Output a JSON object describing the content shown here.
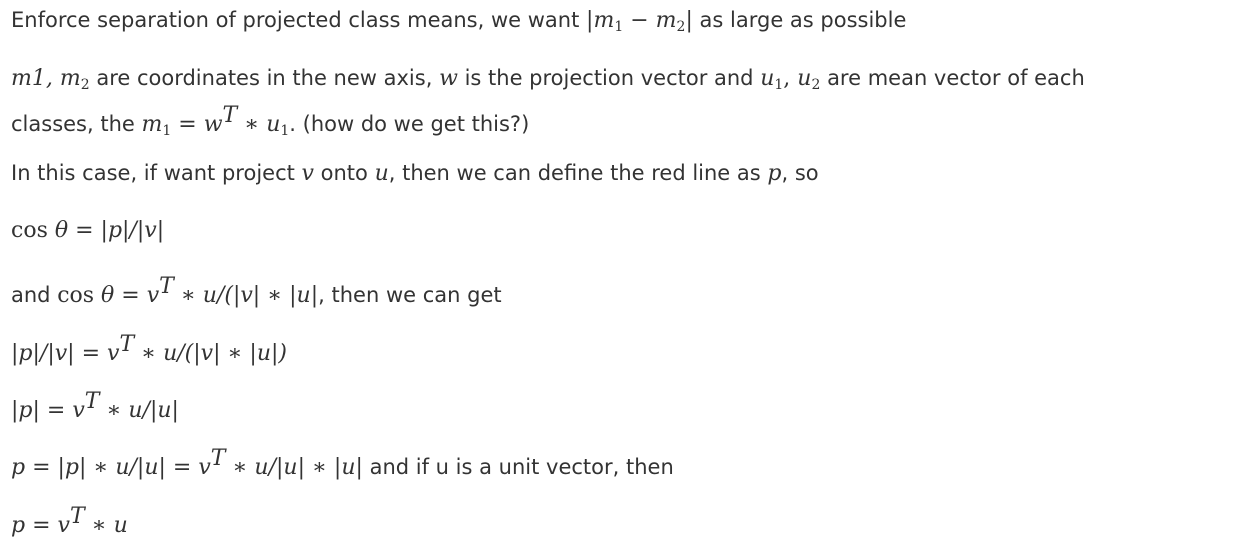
{
  "lines": {
    "l1": {
      "t1": "Enforce separation of projected class means, we want ",
      "math": [
        "|",
        "m",
        "1",
        " − ",
        "m",
        "2",
        "|"
      ],
      "t2": " as large as possible"
    },
    "l2": {
      "m1": "m1, ",
      "m2": "m",
      "m2sub": "2",
      "t1": " are coordinates in the new axis, ",
      "w": "w",
      "t2": " is the projection vector and ",
      "u": "u",
      "u1sub": "1",
      "comma": ", ",
      "u2": "u",
      "u2sub": "2",
      "t3": " are mean vector of each"
    },
    "l3": {
      "t1": "classes, the ",
      "m": "m",
      "msub": "1",
      "eq": " = ",
      "w": "w",
      "wsup": "T",
      "star": " ∗ ",
      "u": "u",
      "usub": "1",
      "t2": ". (how do we get this?)"
    },
    "l4": {
      "t1": "In this case, if want project ",
      "v": "v",
      "t2": " onto ",
      "u": "u",
      "t3": ", then we can define the red line as ",
      "p": "p",
      "t4": ", so"
    },
    "l5": {
      "cos": "cos ",
      "theta": "θ",
      "rest": " = |p|/|v|"
    },
    "l6": {
      "t1": "and ",
      "cos": "cos ",
      "theta": "θ",
      "eq": " = ",
      "v": "v",
      "sup": "T",
      "rest": " ∗ u/(|v| ∗ |u|",
      "t2": ", then we can get"
    },
    "l7": {
      "lhs": "|p|/|v| = ",
      "v": "v",
      "sup": "T",
      "rest": " ∗ u/(|v| ∗ |u|)"
    },
    "l8": {
      "lhs": "|p| = ",
      "v": "v",
      "sup": "T",
      "rest": " ∗ u/|u|"
    },
    "l9": {
      "lhs": "p = |p| ∗ u/|u| = ",
      "v": "v",
      "sup": "T",
      "rest": " ∗ u/|u| ∗ |u|",
      "t1": " and if u is a unit vector, then"
    },
    "l10": {
      "lhs": "p = ",
      "v": "v",
      "sup": "T",
      "rest": " ∗ u"
    }
  }
}
